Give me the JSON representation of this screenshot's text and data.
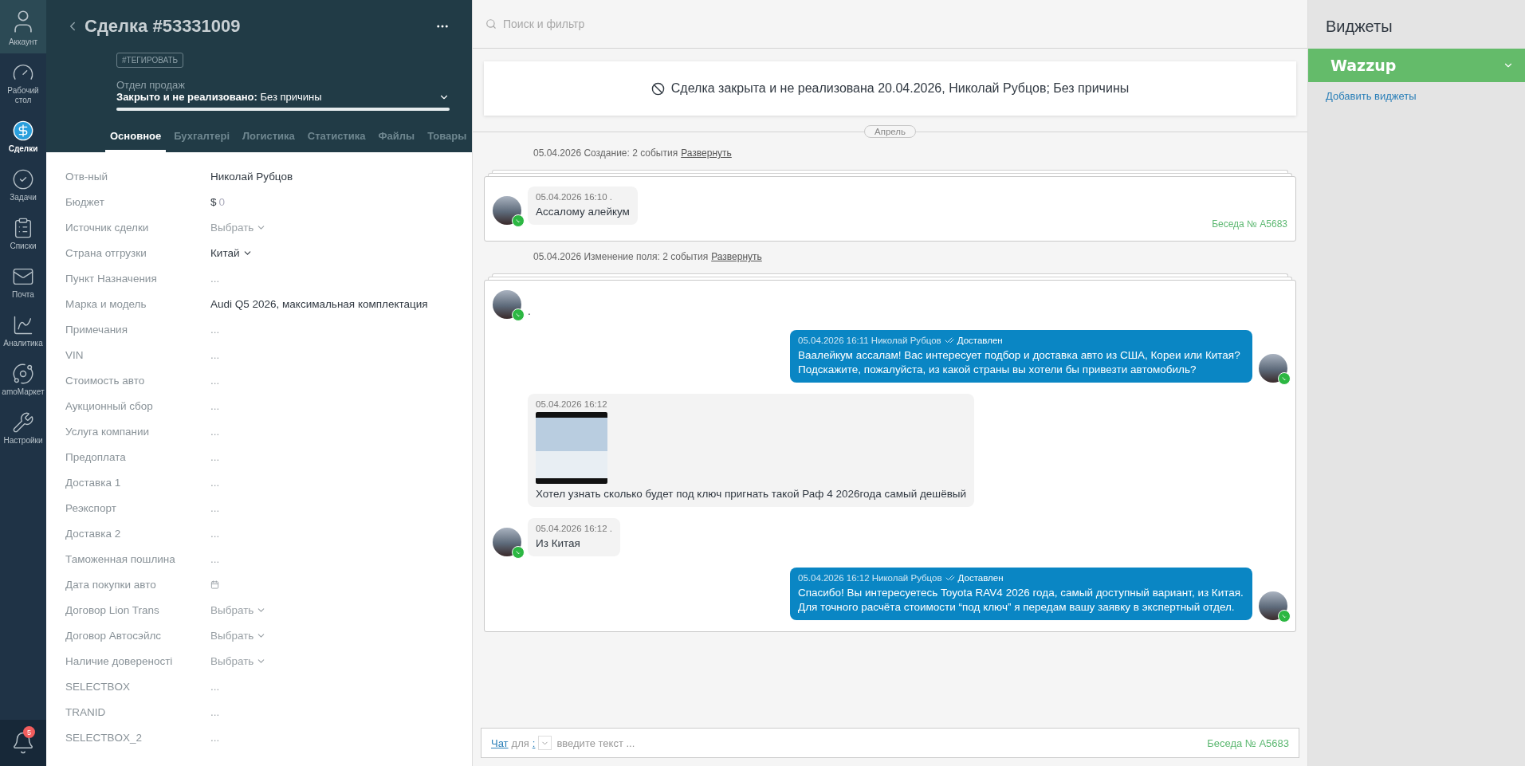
{
  "nav": [
    {
      "label": "Аккаунт",
      "selected": false
    },
    {
      "label": "Рабочий стол",
      "selected": false
    },
    {
      "label": "Сделки",
      "selected": true
    },
    {
      "label": "Задачи",
      "selected": false
    },
    {
      "label": "Списки",
      "selected": false
    },
    {
      "label": "Почта",
      "selected": false
    },
    {
      "label": "Аналитика",
      "selected": false
    },
    {
      "label": "amoМаркет",
      "selected": false
    },
    {
      "label": "Настройки",
      "selected": false
    }
  ],
  "notifications": {
    "count": "5"
  },
  "deal": {
    "title": "Сделка #53331009",
    "tag_button": "#ТЕГИРОВАТЬ",
    "pipeline": "Отдел продаж",
    "status": "**Закрыто и не реализовано:** Без причины",
    "level": 1
  },
  "tabs": [
    {
      "label": "Основное",
      "selected": true
    },
    {
      "label": "Бухгалтері",
      "selected": false
    },
    {
      "label": "Логистика",
      "selected": false
    },
    {
      "label": "Статистика",
      "selected": false
    },
    {
      "label": "Файлы",
      "selected": false
    },
    {
      "label": "Товары",
      "selected": false
    }
  ],
  "fields": [
    {
      "label": "Отв-ный",
      "kind": "text",
      "value": "Николай Рубцов"
    },
    {
      "label": "Бюджет",
      "kind": "money",
      "currency": "$",
      "value": "0"
    },
    {
      "label": "Источник сделки",
      "kind": "select",
      "placeholder": "Выбрать"
    },
    {
      "label": "Страна отгрузки",
      "kind": "select",
      "value": "Китай"
    },
    {
      "label": "Пункт Назначения",
      "kind": "empty",
      "value": "..."
    },
    {
      "label": "Марка и модель",
      "kind": "text",
      "value": "Audi Q5 2026, максимальная комплектация"
    },
    {
      "label": "Примечания",
      "kind": "empty",
      "value": "..."
    },
    {
      "label": "VIN",
      "kind": "empty",
      "value": "..."
    },
    {
      "label": "Стоимость авто",
      "kind": "empty",
      "value": "..."
    },
    {
      "label": "Аукционный сбор",
      "kind": "empty",
      "value": "..."
    },
    {
      "label": "Услуга компании",
      "kind": "empty",
      "value": "..."
    },
    {
      "label": "Предоплата",
      "kind": "empty",
      "value": "..."
    },
    {
      "label": "Доставка 1",
      "kind": "empty",
      "value": "..."
    },
    {
      "label": "Реэкспорт",
      "kind": "empty",
      "value": "..."
    },
    {
      "label": "Доставка 2",
      "kind": "empty",
      "value": "..."
    },
    {
      "label": "Таможенная пошлина",
      "kind": "empty",
      "value": "..."
    },
    {
      "label": "Дата покупки авто",
      "kind": "date"
    },
    {
      "label": "Договор Lion Trans",
      "kind": "select",
      "placeholder": "Выбрать"
    },
    {
      "label": "Договор Автосэйлс",
      "kind": "select",
      "placeholder": "Выбрать"
    },
    {
      "label": "Наличие довереності",
      "kind": "select",
      "placeholder": "Выбрать"
    },
    {
      "label": "SELECTBOX",
      "kind": "empty",
      "value": "..."
    },
    {
      "label": "TRANID",
      "kind": "empty",
      "value": "..."
    },
    {
      "label": "SELECTBOX_2",
      "kind": "empty",
      "value": "..."
    }
  ],
  "search": {
    "placeholder": "Поиск и фильтр"
  },
  "closed_banner": "Сделка закрыта и не реализована 20.04.2026, Николай Рубцов; Без причины",
  "month_divider": "Апрель",
  "groups": [
    {
      "summary": "05.04.2026 Создание: 2 события",
      "expand_link": "Развернуть",
      "conversation": "Беседа № A5683",
      "messages": [
        {
          "kind": "incoming",
          "meta": "05.04.2026 16:10 .",
          "text": "Ассалому алейкум"
        }
      ]
    },
    {
      "summary": "05.04.2026 Изменение поля: 2 события",
      "expand_link": "Развернуть",
      "messages": [
        {
          "kind": "bare",
          "text": "."
        },
        {
          "kind": "outgoing",
          "meta": "05.04.2026 16:11 Николай Рубцов",
          "status": "Доставлен",
          "text": "Ваалейкум ассалам! Вас интересует подбор и доставка авто из США, Кореи или Китая? Подскажите, пожалуйста, из какой страны вы хотели бы привезти автомобиль?"
        },
        {
          "kind": "image",
          "meta": "05.04.2026 16:12",
          "text": "Хотел узнать сколько будет под ключ пригнать такой Раф 4 2026года самый дешёвый"
        },
        {
          "kind": "incoming",
          "meta": "05.04.2026 16:12 .",
          "text": "Из Китая"
        },
        {
          "kind": "outgoing",
          "meta": "05.04.2026 16:12 Николай Рубцов",
          "status": "Доставлен",
          "text": "Спасибо! Вы интересуетесь Toyota RAV4 2026 года, самый доступный вариант, из Китая. Для точного расчёта стоимости “под ключ” я передам вашу заявку в экспертный отдел."
        }
      ]
    }
  ],
  "composer": {
    "chat_link": "Чат",
    "for_label": "для",
    "recipient": ":",
    "placeholder": "введите текст ...",
    "conversation": "Беседа № A5683"
  },
  "widgets": {
    "title": "Виджеты",
    "items": [
      {
        "name": "Wazzup",
        "expanded": false
      }
    ],
    "add_link": "Добавить виджеты"
  }
}
